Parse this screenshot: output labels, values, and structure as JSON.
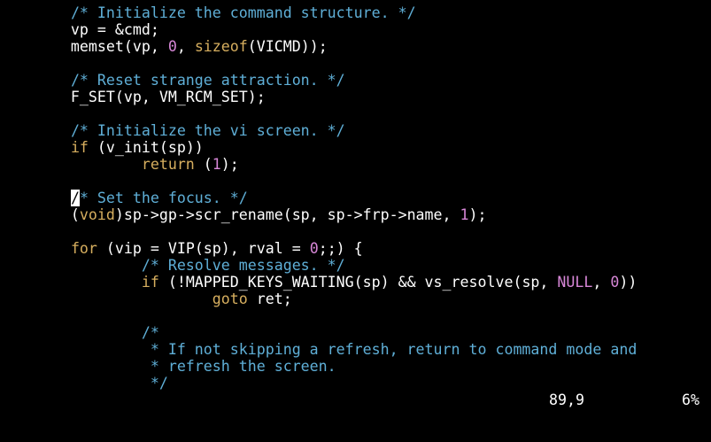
{
  "colors": {
    "background": "#000000",
    "text": "#ffffff",
    "comment": "#5fafd7",
    "keyword": "#d7af5f",
    "constant": "#d787d7",
    "cursor_bg": "#ffffff",
    "cursor_fg": "#000000"
  },
  "code_lines": [
    [
      {
        "t": "        "
      },
      {
        "t": "/* Initialize the command structure. */",
        "k": "comment"
      }
    ],
    [
      {
        "t": "        vp = &cmd;"
      }
    ],
    [
      {
        "t": "        memset(vp, "
      },
      {
        "t": "0",
        "k": "constant"
      },
      {
        "t": ", "
      },
      {
        "t": "sizeof",
        "k": "keyword"
      },
      {
        "t": "(VICMD));"
      }
    ],
    [],
    [
      {
        "t": "        "
      },
      {
        "t": "/* Reset strange attraction. */",
        "k": "comment"
      }
    ],
    [
      {
        "t": "        F_SET(vp, VM_RCM_SET);"
      }
    ],
    [],
    [
      {
        "t": "        "
      },
      {
        "t": "/* Initialize the vi screen. */",
        "k": "comment"
      }
    ],
    [
      {
        "t": "        "
      },
      {
        "t": "if",
        "k": "keyword"
      },
      {
        "t": " (v_init(sp))"
      }
    ],
    [
      {
        "t": "                "
      },
      {
        "t": "return",
        "k": "keyword"
      },
      {
        "t": " ("
      },
      {
        "t": "1",
        "k": "constant"
      },
      {
        "t": ");"
      }
    ],
    [],
    [
      {
        "t": "        "
      },
      {
        "t": "/",
        "k": "cursor"
      },
      {
        "t": "* Set the focus. */",
        "k": "comment"
      }
    ],
    [
      {
        "t": "        ("
      },
      {
        "t": "void",
        "k": "keyword"
      },
      {
        "t": ")sp->gp->scr_rename(sp, sp->frp->name, "
      },
      {
        "t": "1",
        "k": "constant"
      },
      {
        "t": ");"
      }
    ],
    [],
    [
      {
        "t": "        "
      },
      {
        "t": "for",
        "k": "keyword"
      },
      {
        "t": " (vip = VIP(sp), rval = "
      },
      {
        "t": "0",
        "k": "constant"
      },
      {
        "t": ";;) {"
      }
    ],
    [
      {
        "t": "                "
      },
      {
        "t": "/* Resolve messages. */",
        "k": "comment"
      }
    ],
    [
      {
        "t": "                "
      },
      {
        "t": "if",
        "k": "keyword"
      },
      {
        "t": " (!MAPPED_KEYS_WAITING(sp) && vs_resolve(sp, "
      },
      {
        "t": "NULL",
        "k": "constant"
      },
      {
        "t": ", "
      },
      {
        "t": "0",
        "k": "constant"
      },
      {
        "t": "))"
      }
    ],
    [
      {
        "t": "                        "
      },
      {
        "t": "goto",
        "k": "keyword"
      },
      {
        "t": " ret;"
      }
    ],
    [],
    [
      {
        "t": "                "
      },
      {
        "t": "/*",
        "k": "comment"
      }
    ],
    [
      {
        "t": "                 "
      },
      {
        "t": "* If not skipping a refresh, return to command mode and",
        "k": "comment"
      }
    ],
    [
      {
        "t": "                 "
      },
      {
        "t": "* refresh the screen.",
        "k": "comment"
      }
    ],
    [
      {
        "t": "                 "
      },
      {
        "t": "*/",
        "k": "comment"
      }
    ]
  ],
  "status": {
    "position": "89,9",
    "percent": "6%"
  }
}
